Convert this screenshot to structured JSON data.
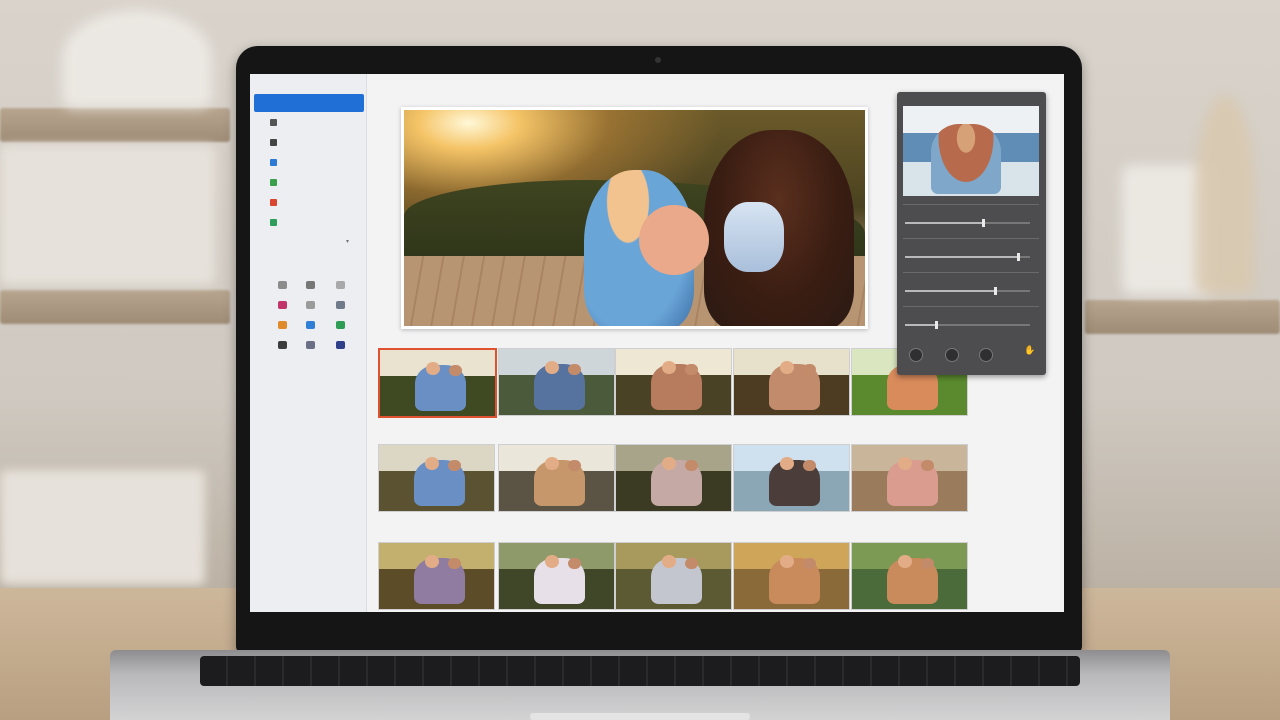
{
  "app": {
    "title": "",
    "window_controls": [
      "close",
      "minimize",
      "zoom"
    ]
  },
  "sidebar": {
    "active_item": {
      "label": "",
      "icon": "photos-icon"
    },
    "items": [
      {
        "label": "",
        "icon": "pen-icon",
        "color": "#555555"
      },
      {
        "label": "",
        "icon": "square-icon",
        "color": "#444444"
      },
      {
        "label": "",
        "icon": "folder-icon",
        "color": "#2b7bd6"
      },
      {
        "label": "",
        "icon": "check-icon",
        "color": "#3aa04b"
      },
      {
        "label": "",
        "icon": "record-icon",
        "color": "#d9452f"
      },
      {
        "label": "",
        "icon": "share-icon",
        "color": "#2f9d5b"
      }
    ],
    "section_heading": "",
    "tabs": [
      "",
      ""
    ],
    "swatches": [
      "#8c8c8c",
      "#777777",
      "#a8a8a8",
      "#c2356a",
      "#9a9a9a",
      "#6f7a8a",
      "#e08a2a",
      "#2f7fd8",
      "#2e9d54",
      "#3c3c3c",
      "#6b6f86",
      "#2f3f8a"
    ]
  },
  "main_photo": {
    "description_icon": "photo-icon"
  },
  "thumbnails": [
    {
      "sky": "#e9e3cf",
      "ground": "#3f4a22",
      "people": "#6a8fc4",
      "selected": true,
      "caption": ""
    },
    {
      "sky": "#cfd6da",
      "ground": "#4b5a3b",
      "people": "#5673a0",
      "selected": false,
      "caption": ""
    },
    {
      "sky": "#eee7d3",
      "ground": "#4a4224",
      "people": "#b77b5e",
      "selected": false,
      "caption": ""
    },
    {
      "sky": "#e7e0cb",
      "ground": "#4d3b22",
      "people": "#c28b6c",
      "selected": false,
      "caption": ""
    },
    {
      "sky": "#d9e6c0",
      "ground": "#5b8a2e",
      "people": "#d98b5c",
      "selected": false,
      "caption": ""
    },
    {
      "sky": "#dcd7c4",
      "ground": "#5a5230",
      "people": "#6a8fc4",
      "selected": false,
      "caption": ""
    },
    {
      "sky": "#ebe6da",
      "ground": "#5b5344",
      "people": "#c7976c",
      "selected": false,
      "caption": ""
    },
    {
      "sky": "#a8a48a",
      "ground": "#3b3a22",
      "people": "#c5a9a4",
      "selected": false,
      "caption": ""
    },
    {
      "sky": "#cfe0ee",
      "ground": "#8ba6b5",
      "people": "#4a3d3a",
      "selected": false,
      "caption": ""
    },
    {
      "sky": "#c9b59a",
      "ground": "#9a7c5c",
      "people": "#d99c8f",
      "selected": false,
      "caption": ""
    },
    {
      "sky": "#c3b06f",
      "ground": "#5c4c28",
      "people": "#8f7ca0",
      "selected": false,
      "caption": ""
    },
    {
      "sky": "#8f9a6a",
      "ground": "#3f4728",
      "people": "#e7e0e9",
      "selected": false,
      "caption": ""
    },
    {
      "sky": "#a89a5c",
      "ground": "#5b5a33",
      "people": "#c4c6cf",
      "selected": false,
      "caption": ""
    },
    {
      "sky": "#cfa55a",
      "ground": "#8a6a38",
      "people": "#c98a5c",
      "selected": false,
      "caption": ""
    },
    {
      "sky": "#7d9a55",
      "ground": "#4b6b3a",
      "people": "#c98a5c",
      "selected": false,
      "caption": ""
    }
  ],
  "adjust_panel": {
    "rows": [
      {
        "label": "",
        "value": "",
        "level": 0.62
      },
      {
        "label": "",
        "value": "",
        "level": 0.9
      },
      {
        "label": "",
        "value": "",
        "level": 0.72
      },
      {
        "label": "",
        "value": "",
        "level": 0.25
      }
    ],
    "buttons": [
      "circle-button",
      "circle-button",
      "circle-button"
    ],
    "pointer_icon": "hand-pointer-icon"
  }
}
